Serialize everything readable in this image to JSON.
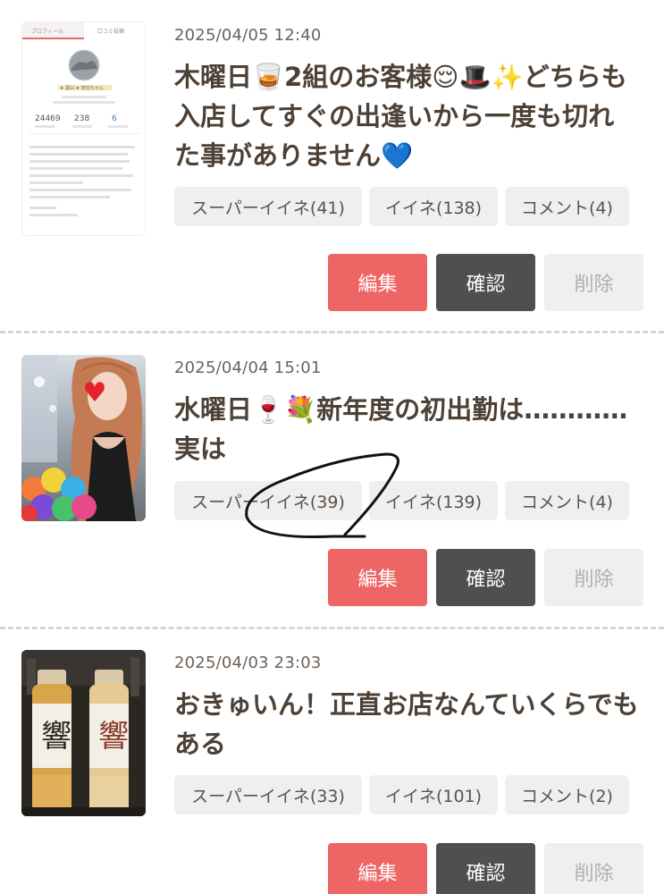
{
  "posts": [
    {
      "date": "2025/04/05 12:40",
      "title": "木曜日🥃2組のお客様😌🎩✨どちらも入店してすぐの出逢いから一度も切れた事がありません💙",
      "super_like": "スーパーイイネ(41)",
      "like": "イイネ(138)",
      "comment": "コメント(4)",
      "thumb_icon": "profile-screenshot",
      "thumb_tabs": [
        "プロフィール",
        "口コミ投稿"
      ],
      "thumb_name": "★ 葉山 ★ 夜空ちゃん",
      "thumb_stats": [
        "24469",
        "238",
        "6"
      ]
    },
    {
      "date": "2025/04/04 15:01",
      "title": "水曜日🍷💐新年度の初出勤は…………実は",
      "super_like": "スーパーイイネ(39)",
      "like": "イイネ(139)",
      "comment": "コメント(4)",
      "thumb_icon": "woman-with-flowers-photo"
    },
    {
      "date": "2025/04/03 23:03",
      "title": "おきゅいん！正直お店なんていくらでもある",
      "super_like": "スーパーイイネ(33)",
      "like": "イイネ(101)",
      "comment": "コメント(2)",
      "thumb_icon": "whisky-bottles-photo"
    }
  ],
  "buttons": {
    "edit": "編集",
    "confirm": "確認",
    "delete": "削除"
  },
  "colors": {
    "edit": "#ee6565",
    "confirm": "#4f4f4f",
    "delete": "#efefef",
    "tag": "#efefef",
    "title": "#4d4035"
  }
}
